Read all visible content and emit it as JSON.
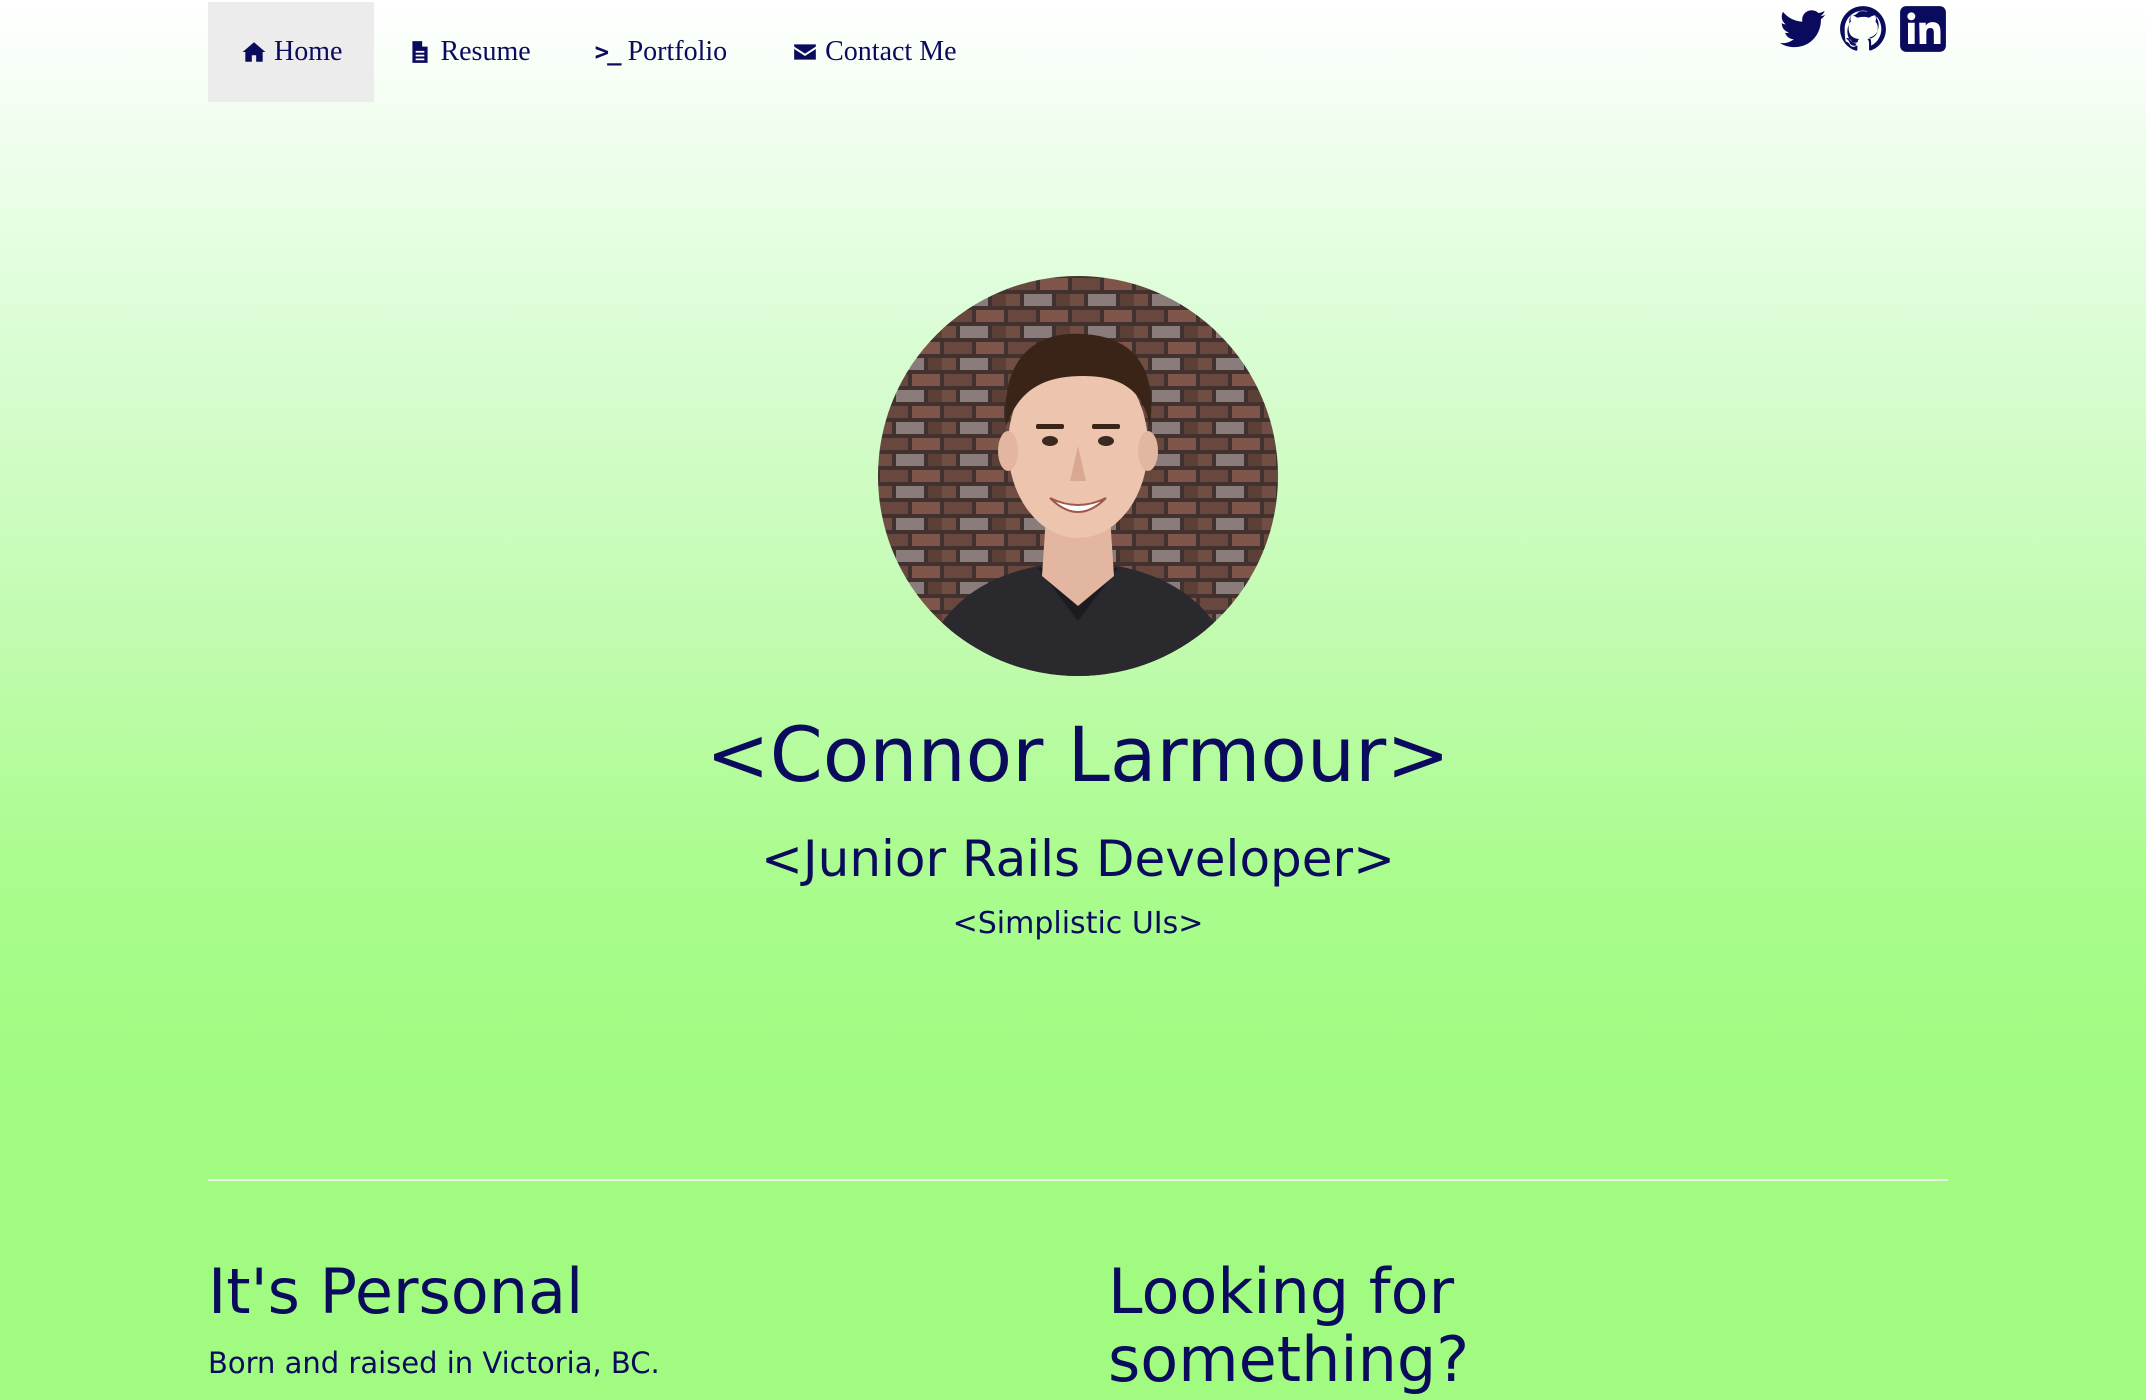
{
  "nav": {
    "items": [
      {
        "label": "Home",
        "icon": "home-icon",
        "active": true
      },
      {
        "label": "Resume",
        "icon": "document-icon",
        "active": false
      },
      {
        "label": "Portfolio",
        "icon": "terminal-icon",
        "active": false
      },
      {
        "label": "Contact Me",
        "icon": "envelope-icon",
        "active": false
      }
    ],
    "prompt_glyph": ">_"
  },
  "social": [
    "twitter-icon",
    "github-icon",
    "linkedin-icon"
  ],
  "hero": {
    "name": "<Connor Larmour>",
    "title": "<Junior Rails Developer>",
    "subtitle": "<Simplistic UIs>"
  },
  "sections": {
    "personal": {
      "heading": "It's Personal",
      "text": "Born and raised in Victoria, BC."
    },
    "looking": {
      "heading": "Looking for something?"
    }
  },
  "colors": {
    "text": "#0b0b5e",
    "nav_active_bg": "#ececec",
    "gradient_top": "#ffffff",
    "gradient_bottom": "#a0fb80"
  }
}
